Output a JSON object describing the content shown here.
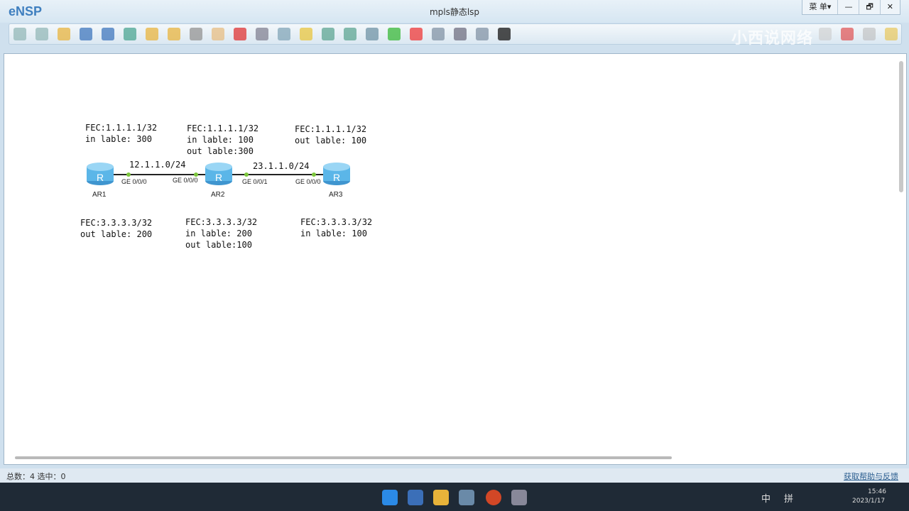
{
  "app": {
    "logo": "eNSP",
    "title": "mpls静态lsp",
    "menu_label": "菜 单▾",
    "minimize": "—",
    "restore": "🗗",
    "close": "✕",
    "watermark": "小西说网络"
  },
  "toolbar": {
    "icons": [
      "new-topology-icon",
      "new-lab-icon",
      "open-icon",
      "save-icon",
      "save-as-icon",
      "print-icon",
      "undo-icon",
      "redo-icon",
      "select-icon",
      "pan-hand-icon",
      "delete-icon",
      "delete-link-icon",
      "text-annotation-icon",
      "rectangle-icon",
      "zoom-in-icon",
      "zoom-out-icon",
      "fit-view-icon",
      "start-device-icon",
      "stop-device-icon",
      "capture-icon",
      "topology-icon",
      "panel-icon",
      "console-icon"
    ],
    "right_icons": [
      "message-icon",
      "huawei-icon",
      "settings-icon",
      "help-icon"
    ]
  },
  "topology": {
    "routers": [
      {
        "name": "AR1"
      },
      {
        "name": "AR2"
      },
      {
        "name": "AR3"
      }
    ],
    "links": [
      {
        "network": "12.1.1.0/24",
        "if_a": "GE 0/0/0",
        "if_b": "GE 0/0/0"
      },
      {
        "network": "23.1.1.0/24",
        "if_a": "GE 0/0/1",
        "if_b": "GE 0/0/0"
      }
    ],
    "labels_top": [
      "FEC:1.1.1.1/32\nin lable: 300",
      "FEC:1.1.1.1/32\nin lable: 100\nout lable:300",
      "FEC:1.1.1.1/32\nout lable: 100"
    ],
    "labels_bottom": [
      "FEC:3.3.3.3/32\nout lable: 200",
      "FEC:3.3.3.3/32\nin lable: 200\nout lable:100",
      "FEC:3.3.3.3/32\nin lable: 100"
    ]
  },
  "status": {
    "left": "总数：4 选中：0",
    "help_link": "获取帮助与反馈"
  },
  "taskbar": {
    "ime_lang": "中",
    "ime_mode": "拼",
    "time": "15:46",
    "date": "2023/1/17"
  },
  "colors": {
    "accent": "#3f7fbf",
    "router": "#5bb6e8",
    "link": "#222222",
    "port": "#7cc63d"
  }
}
